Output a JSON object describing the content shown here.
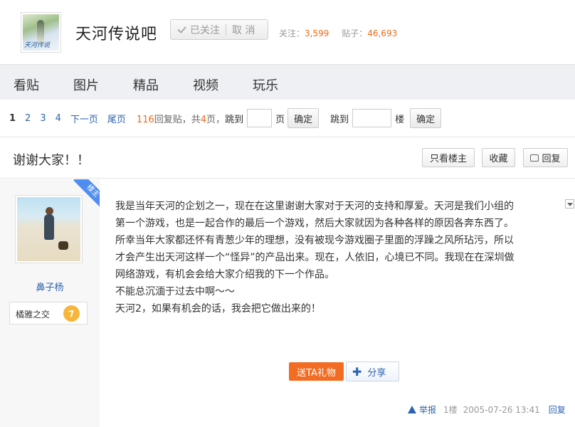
{
  "forum": {
    "name": "天河传说吧",
    "avatar_caption": "天河传说",
    "follow_label": "已关注",
    "cancel_label": "取 消",
    "followers_label": "关注：",
    "followers_value": "3,599",
    "posts_label": "贴子：",
    "posts_value": "46,693"
  },
  "nav": {
    "tabs": [
      "看贴",
      "图片",
      "精品",
      "视频",
      "玩乐"
    ]
  },
  "pager": {
    "pages": [
      "1",
      "2",
      "3",
      "4"
    ],
    "next_label": "下一页",
    "last_label": "尾页",
    "reply_count": "116",
    "reply_text": "回复贴，共",
    "total_pages": "4",
    "total_pages_suffix": "页，",
    "jump_label": "跳到",
    "page_unit": "页",
    "confirm_label": "确定",
    "floor_jump_label": "跳到",
    "floor_unit": "楼",
    "floor_confirm_label": "确定"
  },
  "thread": {
    "title": "谢谢大家！！",
    "only_op_label": "只看楼主",
    "favorite_label": "收藏",
    "reply_label": "回复"
  },
  "post": {
    "op_badge": "楼主",
    "username": "鼻子杨",
    "badge_label": "橘雅之交",
    "badge_level": "7",
    "lines": [
      "我是当年天河的企划之一，现在在这里谢谢大家对于天河的支持和厚爱。天河是我们小组的",
      "第一个游戏，也是一起合作的最后一个游戏，然后大家就因为各种各样的原因各奔东西了。",
      "所幸当年大家都还怀有青葱少年的理想，没有被现今游戏圈子里面的浮躁之风所玷污，所以",
      "才会产生出天河这样一个“怪异”的产品出来。现在，人依旧，心境已不同。我现在在深圳做",
      "网络游戏，有机会会给大家介绍我的下一个作品。",
      "不能总沉湎于过去中啊～～",
      "天河2，如果有机会的话，我会把它做出来的！"
    ],
    "gift_label": "送TA礼物",
    "share_label": "分享",
    "report_label": "举报",
    "floor": "1楼",
    "timestamp": "2005-07-26 13:41",
    "reply_link": "回复"
  },
  "colors": {
    "accent_blue": "#2d64b3",
    "accent_orange": "#f06b18",
    "nav_bg": "#eef0f4"
  }
}
